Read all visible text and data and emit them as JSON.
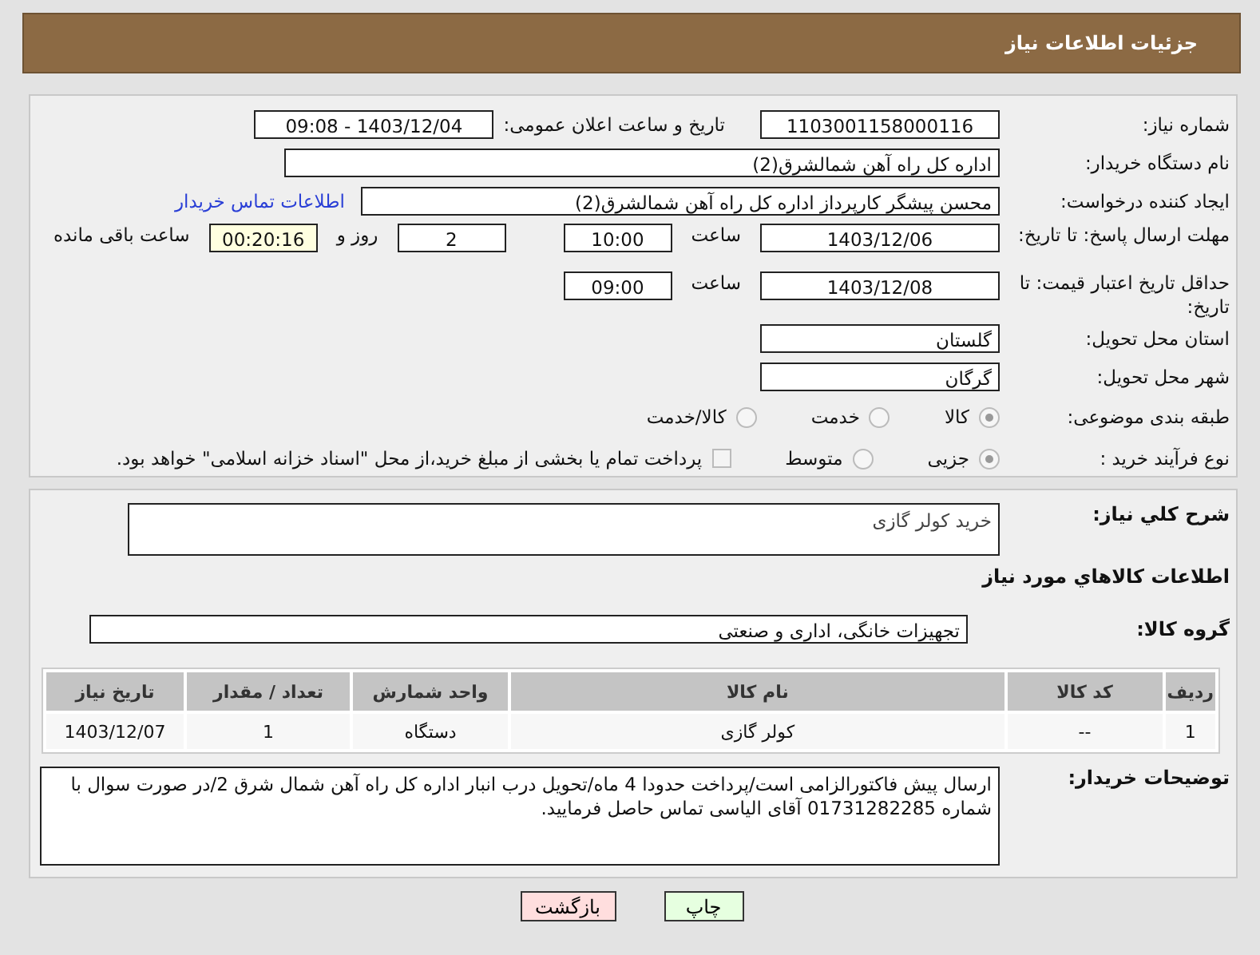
{
  "header": {
    "title": "جزئیات اطلاعات نیاز"
  },
  "details": {
    "need_number": {
      "label": "شماره نیاز:",
      "value": "1103001158000116"
    },
    "announce": {
      "label": "تاریخ و ساعت اعلان عمومی:",
      "value": "1403/12/04 - 09:08"
    },
    "buyer_org": {
      "label": "نام دستگاه خریدار:",
      "value": "اداره کل راه آهن شمالشرق(2)"
    },
    "requester": {
      "label": "ایجاد کننده درخواست:",
      "value": "محسن پیشگر کارپرداز اداره کل راه آهن شمالشرق(2)",
      "link": "اطلاعات تماس خریدار"
    },
    "response_deadline": {
      "label": "مهلت ارسال پاسخ: تا تاریخ:",
      "date": "1403/12/06",
      "time_label": "ساعت",
      "time": "10:00",
      "days": "2",
      "days_label": "روز و",
      "remaining": "00:20:16",
      "remaining_label": "ساعت باقی مانده"
    },
    "price_validity": {
      "label": "حداقل تاریخ اعتبار قیمت: تا تاریخ:",
      "date": "1403/12/08",
      "time_label": "ساعت",
      "time": "09:00"
    },
    "province": {
      "label": "استان محل تحویل:",
      "value": "گلستان"
    },
    "city": {
      "label": "شهر محل تحویل:",
      "value": "گرگان"
    },
    "category": {
      "label": "طبقه بندی موضوعی:",
      "options": [
        {
          "label": "کالا",
          "selected": true
        },
        {
          "label": "خدمت",
          "selected": false
        },
        {
          "label": "کالا/خدمت",
          "selected": false
        }
      ]
    },
    "purchase_type": {
      "label": "نوع فرآیند خرید :",
      "options": [
        {
          "label": "جزیی",
          "selected": true
        },
        {
          "label": "متوسط",
          "selected": false
        }
      ],
      "note": {
        "label": "پرداخت تمام یا بخشی از مبلغ خرید،از محل \"اسناد خزانه اسلامی\" خواهد بود.",
        "checked": false
      }
    }
  },
  "description": {
    "label": "شرح کلي نياز:",
    "value": "خرید کولر گازی"
  },
  "goods_title": "اطلاعات کالاهاي مورد نياز",
  "goods_group": {
    "label": "گروه کالا:",
    "value": "تجهیزات خانگی، اداری و صنعتی"
  },
  "table": {
    "columns": [
      "ردیف",
      "کد کالا",
      "نام کالا",
      "واحد شمارش",
      "تعداد / مقدار",
      "تاریخ نیاز"
    ],
    "rows": [
      [
        "1",
        "--",
        "کولر گازی",
        "دستگاه",
        "1",
        "1403/12/07"
      ]
    ]
  },
  "buyer_notes": {
    "label": "توضیحات خریدار:",
    "value": "ارسال پیش فاکتورالزامی است/پرداخت حدودا 4 ماه/تحویل درب انبار اداره کل راه آهن شمال شرق 2/در صورت سوال با شماره 01731282285 آقای الیاسی تماس حاصل فرمایید."
  },
  "buttons": [
    {
      "label": "چاپ",
      "kind": "print"
    },
    {
      "label": "بازگشت",
      "kind": "back"
    }
  ]
}
